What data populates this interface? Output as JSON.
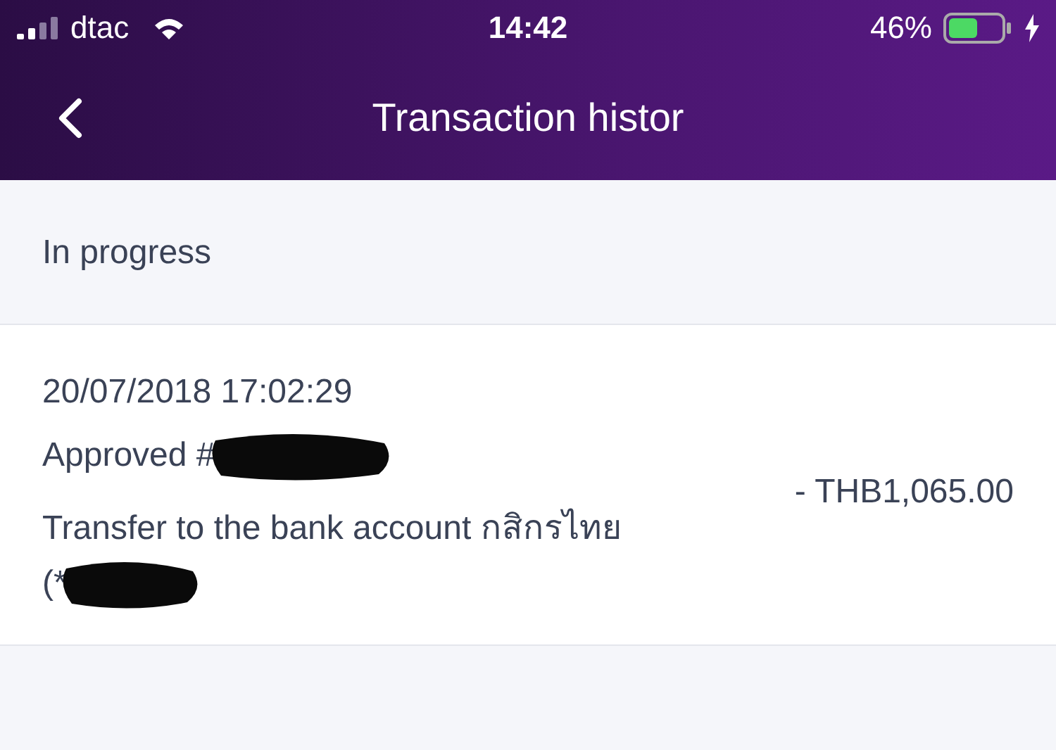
{
  "status_bar": {
    "carrier": "dtac",
    "time": "14:42",
    "battery": "46%"
  },
  "header": {
    "title": "Transaction histor"
  },
  "section": {
    "title": "In progress"
  },
  "transactions": [
    {
      "datetime": "20/07/2018 17:02:29",
      "reference": "Approved #",
      "description": "Transfer to the bank account กสิกรไทย",
      "account": "(*",
      "amount": "- THB1,065.00"
    }
  ]
}
